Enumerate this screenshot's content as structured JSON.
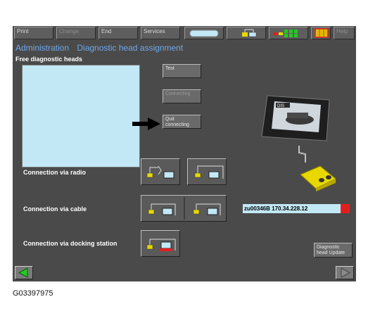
{
  "toolbar": {
    "print": "Print",
    "change": "Change",
    "end": "End",
    "services": "Services",
    "help": "Help"
  },
  "header": {
    "section": "Administration",
    "page": "Diagnostic head assignment"
  },
  "free_heads": {
    "label": "Free diagnostic heads"
  },
  "buttons": {
    "test": "Test",
    "connecting": "Connecting",
    "quit_connecting": "Quit connecting",
    "head_update": "Diagnostic head Update"
  },
  "connections": {
    "radio": "Connection via radio",
    "cable": "Connection via cable",
    "docking": "Connection via docking station"
  },
  "device": {
    "screen_text": "DIS"
  },
  "address": {
    "value": "zu00346B 170.34.228.12"
  },
  "caption": "G03397975",
  "colors": {
    "background": "#4a4a4a",
    "title": "#6ea8e8",
    "listbox": "#c2e8f5",
    "status_red": "#e02020",
    "head_yellow": "#e8d800"
  }
}
